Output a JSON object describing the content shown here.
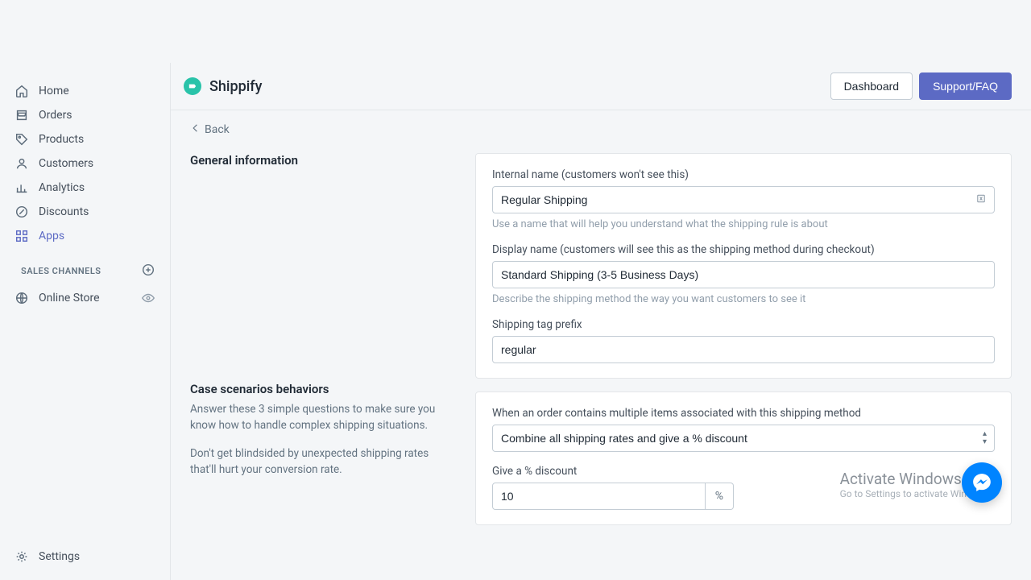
{
  "sidebar": {
    "items": [
      {
        "label": "Home"
      },
      {
        "label": "Orders"
      },
      {
        "label": "Products"
      },
      {
        "label": "Customers"
      },
      {
        "label": "Analytics"
      },
      {
        "label": "Discounts"
      },
      {
        "label": "Apps"
      }
    ],
    "channels_label": "SALES CHANNELS",
    "channel_item": "Online Store",
    "settings": "Settings"
  },
  "header": {
    "app_name": "Shippify",
    "dashboard": "Dashboard",
    "support": "Support/FAQ"
  },
  "back": "Back",
  "sections": {
    "general_title": "General information",
    "case_title": "Case scenarios behaviors",
    "case_desc1": "Answer these 3 simple questions to make sure you know how to handle complex shipping situations.",
    "case_desc2": "Don't get blindsided by unexpected shipping rates that'll hurt your conversion rate."
  },
  "form": {
    "internal_label": "Internal name (customers won't see this)",
    "internal_value": "Regular Shipping",
    "internal_help": "Use a name that will help you understand what the shipping rule is about",
    "display_label": "Display name (customers will see this as the shipping method during checkout)",
    "display_value": "Standard Shipping (3-5 Business Days)",
    "display_help": "Describe the shipping method the way you want customers to see it",
    "tag_label": "Shipping tag prefix",
    "tag_value": "regular",
    "multi_label": "When an order contains multiple items associated with this shipping method",
    "multi_value": "Combine all shipping rates and give a % discount",
    "discount_label": "Give a % discount",
    "discount_value": "10",
    "discount_unit": "%"
  },
  "watermark": {
    "line1": "Activate Windows",
    "line2": "Go to Settings to activate Windows."
  }
}
